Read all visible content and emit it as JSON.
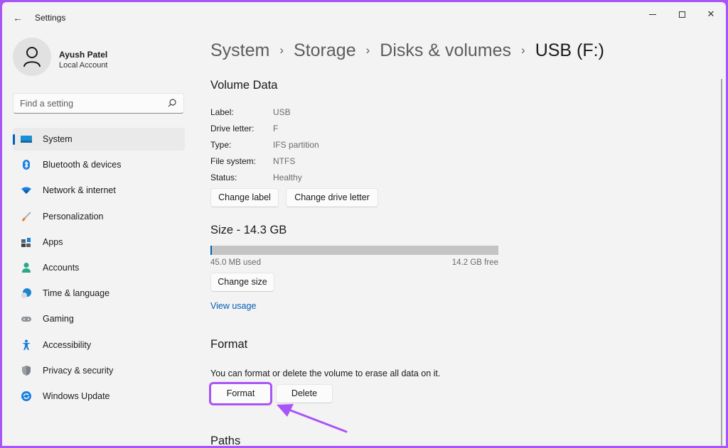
{
  "window": {
    "title": "Settings",
    "controls": {
      "minimize": "minimize",
      "maximize": "maximize",
      "close": "close"
    }
  },
  "profile": {
    "name": "Ayush Patel",
    "account_type": "Local Account"
  },
  "search": {
    "placeholder": "Find a setting",
    "value": ""
  },
  "sidebar": {
    "items": [
      {
        "label": "System",
        "icon": "monitor-icon",
        "active": true
      },
      {
        "label": "Bluetooth & devices",
        "icon": "bluetooth-icon"
      },
      {
        "label": "Network & internet",
        "icon": "wifi-icon"
      },
      {
        "label": "Personalization",
        "icon": "brush-icon"
      },
      {
        "label": "Apps",
        "icon": "apps-icon"
      },
      {
        "label": "Accounts",
        "icon": "person-icon"
      },
      {
        "label": "Time & language",
        "icon": "globe-clock-icon"
      },
      {
        "label": "Gaming",
        "icon": "gamepad-icon"
      },
      {
        "label": "Accessibility",
        "icon": "accessibility-icon"
      },
      {
        "label": "Privacy & security",
        "icon": "shield-icon"
      },
      {
        "label": "Windows Update",
        "icon": "update-icon"
      }
    ]
  },
  "breadcrumb": {
    "items": [
      "System",
      "Storage",
      "Disks & volumes"
    ],
    "current": "USB (F:)",
    "separator": "›"
  },
  "volume_data": {
    "title": "Volume Data",
    "fields": [
      {
        "key": "Label:",
        "value": "USB"
      },
      {
        "key": "Drive letter:",
        "value": "F"
      },
      {
        "key": "Type:",
        "value": "IFS partition"
      },
      {
        "key": "File system:",
        "value": "NTFS"
      },
      {
        "key": "Status:",
        "value": "Healthy"
      }
    ],
    "change_label_button": "Change label",
    "change_drive_letter_button": "Change drive letter"
  },
  "size": {
    "title": "Size - 14.3 GB",
    "used_label": "45.0 MB used",
    "free_label": "14.2 GB free",
    "used_fraction": 0.003,
    "change_size_button": "Change size",
    "view_usage_link": "View usage"
  },
  "format": {
    "title": "Format",
    "description": "You can format or delete the volume to erase all data on it.",
    "format_button": "Format",
    "delete_button": "Delete"
  },
  "paths": {
    "title": "Paths"
  },
  "annotation": {
    "color": "#a855f7",
    "target": "format_button"
  },
  "colors": {
    "accent": "#005fb8",
    "progress_track": "#c4c4c4"
  }
}
